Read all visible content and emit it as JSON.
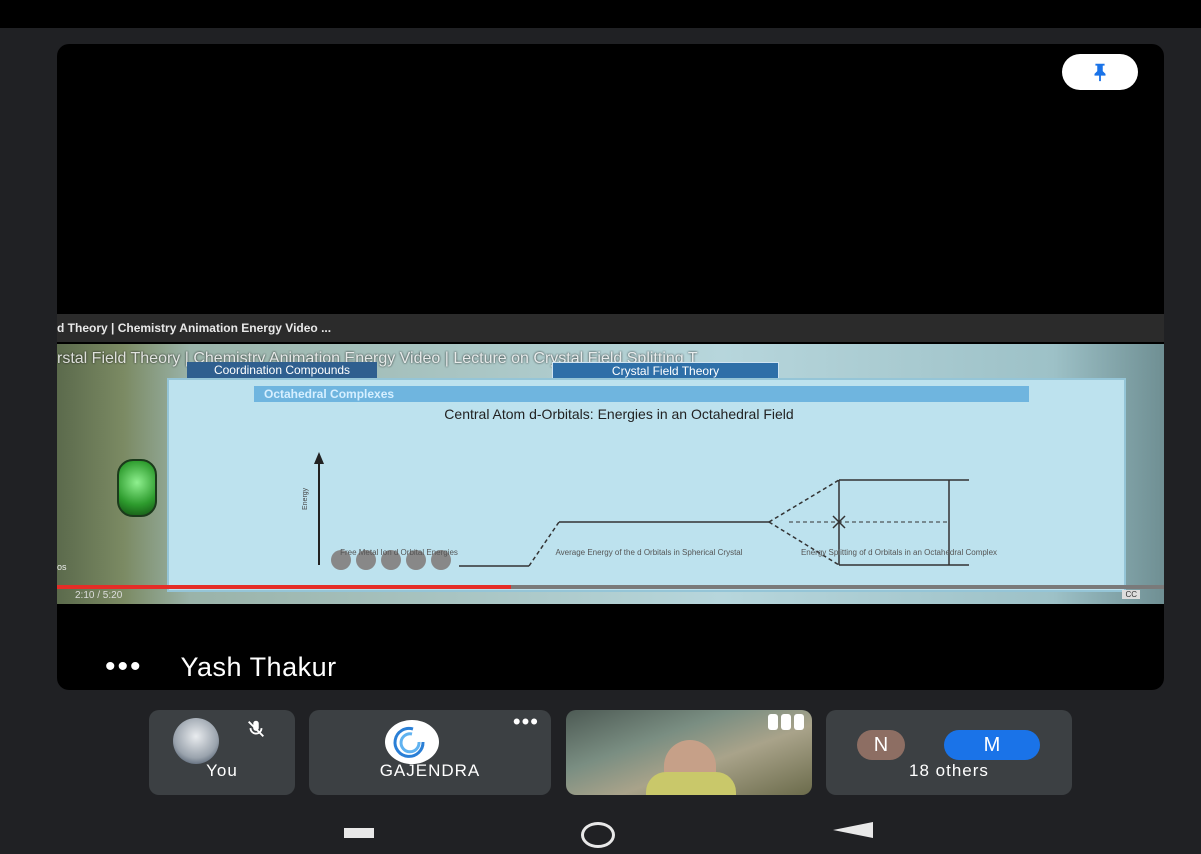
{
  "colors": {
    "background": "#202124",
    "tile": "#3c4043",
    "youtube_red": "#e52d27",
    "chip_n": "#8d6e63",
    "chip_m": "#1a73e8"
  },
  "icons": {
    "pin": "pin-icon",
    "mic_off": "mic-off-icon",
    "more": "more-dots-icon"
  },
  "main": {
    "presenter_name": "Yash Thakur",
    "more_label": "•••",
    "video": {
      "tab_title": "d Theory | Chemistry Animation Energy Video ...",
      "overlay_title": "rstal Field Theory | Chemistry Animation Energy Video | Lecture on Crystal Field Splitting T",
      "tab_left": "Coordination Compounds",
      "tab_right": "Crystal Field Theory",
      "slide_header": "Octahedral Complexes",
      "slide_title": "Central Atom d-Orbitals: Energies in an Octahedral Field",
      "caption_1": "Free Metal Ion d Orbital Energies",
      "caption_2": "Average Energy of the d Orbitals in Spherical Crystal",
      "caption_3": "Energy Splitting of d Orbitals in an Octahedral Complex",
      "energy_axis_label": "Energy",
      "time": "2:10 / 5:20",
      "progress": 0.41,
      "side_text": "os",
      "cc": "CC"
    }
  },
  "participants": [
    {
      "label": "You",
      "mic_muted": true
    },
    {
      "label": "GAJENDRA",
      "more": "•••"
    },
    {
      "label": "",
      "video": true
    },
    {
      "label": "18 others",
      "chips": [
        "N",
        "M"
      ]
    }
  ]
}
